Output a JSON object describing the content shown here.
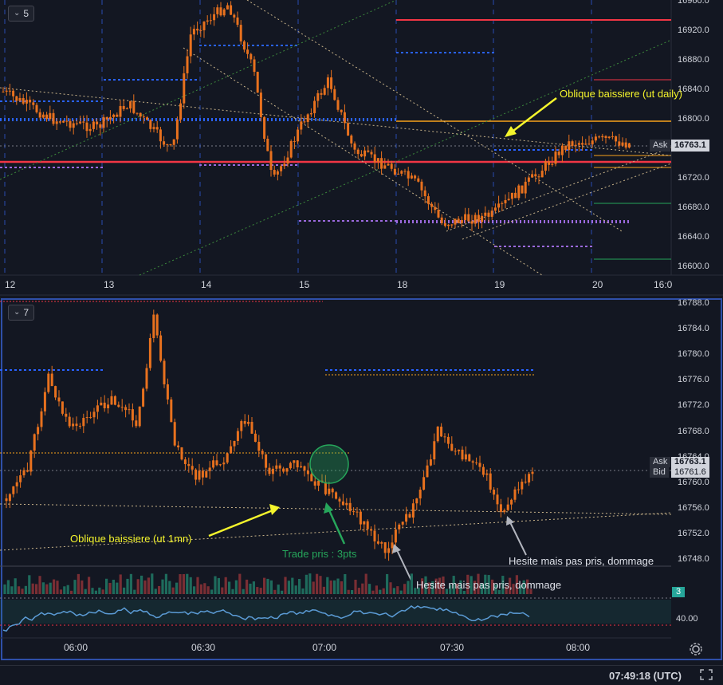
{
  "top_pane": {
    "badge": "5",
    "y_labels": [
      "16960.0",
      "16920.0",
      "16880.0",
      "16840.0",
      "16800.0",
      "16760.0",
      "16720.0",
      "16680.0",
      "16640.0",
      "16600.0"
    ],
    "x_labels": [
      "12",
      "13",
      "14",
      "15",
      "18",
      "19",
      "20",
      "16:0"
    ],
    "ask_label": "Ask",
    "ask_price": "16763.1",
    "annotation": "Oblique baissiere (ut daily)"
  },
  "bottom_pane": {
    "badge": "7",
    "y_labels": [
      "16788.0",
      "16784.0",
      "16780.0",
      "16776.0",
      "16772.0",
      "16768.0",
      "16764.0",
      "16760.0",
      "16756.0",
      "16752.0",
      "16748.0"
    ],
    "ask_label": "Ask",
    "bid_label": "Bid",
    "ask_price": "16763.1",
    "bid_price": "16761.6",
    "annotations": {
      "oblique": "Oblique baissiere (ut 1mn)",
      "trade": "Trade pris : 3pts",
      "hesite_right": "Hesite mais pas pris, dommage",
      "hesite_bottom": "Hesite mais pas pris, dommage"
    },
    "volume_badge": "3",
    "oscillator_label": "40.00"
  },
  "time_axis": [
    "06:00",
    "06:30",
    "07:00",
    "07:30",
    "08:00"
  ],
  "status": {
    "clock": "07:49:18 (UTC)"
  },
  "colors": {
    "background": "#131722",
    "candle": "#e8711e",
    "blue_level": "#2962ff",
    "red_level": "#f23645",
    "purple_level": "#9c6ade",
    "annotation_yellow": "#f5f52c",
    "annotation_green": "#26a65b",
    "oscillator": "#5b9bd5",
    "ask_tag": "#2a2e39"
  },
  "icons": {
    "settings": "gear-icon",
    "fullscreen": "fullscreen-icon",
    "collapse": "chevron-down-icon"
  }
}
